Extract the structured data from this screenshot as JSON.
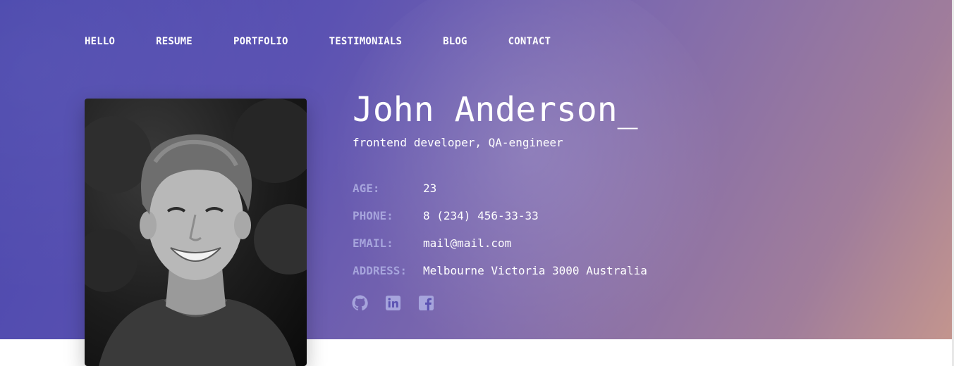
{
  "nav": [
    "HELLO",
    "RESUME",
    "PORTFOLIO",
    "TESTIMONIALS",
    "BLOG",
    "CONTACT"
  ],
  "profile": {
    "name": "John Anderson_",
    "subtitle": "frontend developer, QA-engineer"
  },
  "info": [
    {
      "label": "AGE:",
      "value": "23"
    },
    {
      "label": "PHONE:",
      "value": "8 (234) 456-33-33"
    },
    {
      "label": "EMAIL:",
      "value": "mail@mail.com"
    },
    {
      "label": "ADDRESS:",
      "value": "Melbourne Victoria 3000 Australia"
    }
  ],
  "socials": [
    "github-icon",
    "linkedin-icon",
    "facebook-icon"
  ],
  "colors": {
    "accent": "#4a47ad",
    "gradient_end": "#c3958e",
    "label": "#a6a4dc",
    "text": "#ffffff"
  }
}
